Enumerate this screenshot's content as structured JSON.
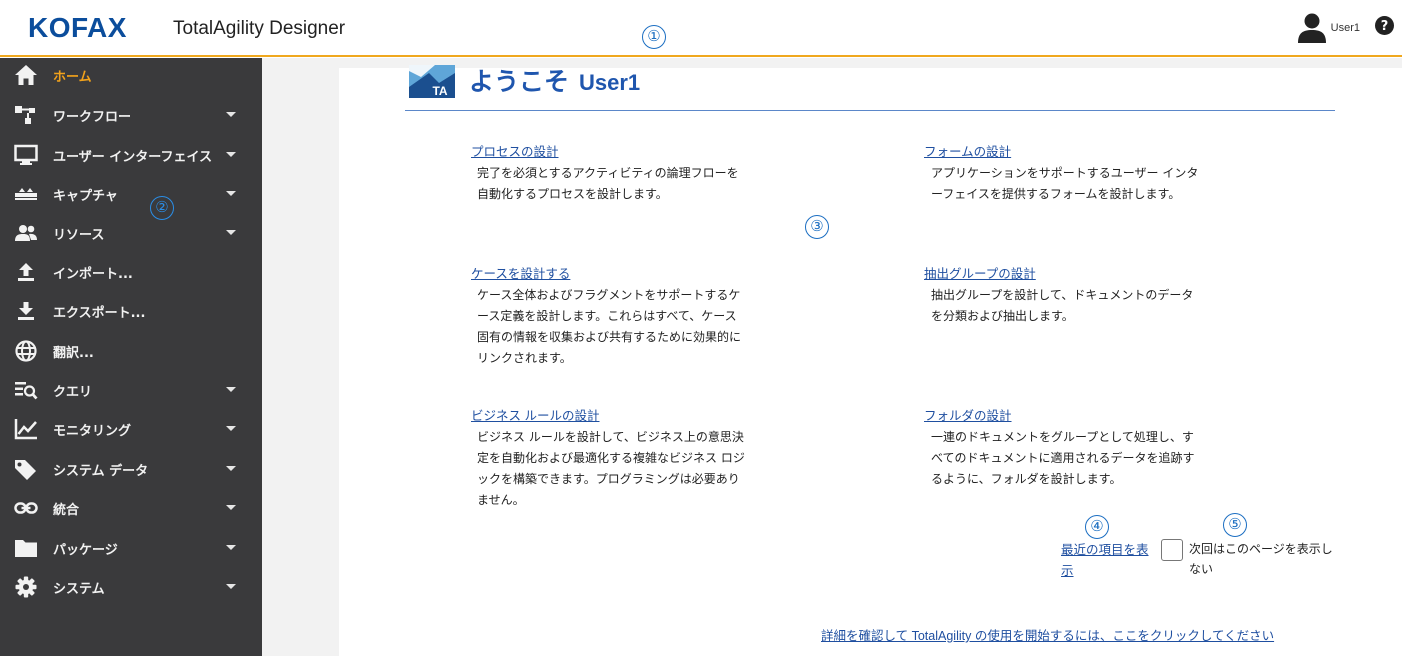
{
  "header": {
    "logo": "KOFAX",
    "app_title": "TotalAgility Designer",
    "user_name": "User1",
    "help_glyph": "?"
  },
  "callouts": [
    "①",
    "②",
    "③",
    "④",
    "⑤"
  ],
  "sidebar": {
    "items": [
      {
        "label": "ホーム",
        "icon": "home-icon",
        "active": true,
        "expandable": false
      },
      {
        "label": "ワークフロー",
        "icon": "workflow-icon",
        "expandable": true
      },
      {
        "label": "ユーザー インターフェイス",
        "icon": "monitor-icon",
        "expandable": true
      },
      {
        "label": "キャプチャ",
        "icon": "scanner-icon",
        "expandable": true
      },
      {
        "label": "リソース",
        "icon": "people-icon",
        "expandable": true
      },
      {
        "label": "インポート...",
        "icon": "upload-icon",
        "expandable": false
      },
      {
        "label": "エクスポート...",
        "icon": "download-icon",
        "expandable": false
      },
      {
        "label": "翻訳...",
        "icon": "globe-icon",
        "expandable": false
      },
      {
        "label": "クエリ",
        "icon": "query-icon",
        "expandable": true
      },
      {
        "label": "モニタリング",
        "icon": "chart-icon",
        "expandable": true
      },
      {
        "label": "システム データ",
        "icon": "tag-icon",
        "expandable": true
      },
      {
        "label": "統合",
        "icon": "link-icon",
        "expandable": true
      },
      {
        "label": "パッケージ",
        "icon": "folder-icon",
        "expandable": true
      },
      {
        "label": "システム",
        "icon": "gear-icon",
        "expandable": true
      }
    ]
  },
  "main": {
    "ta_logo_text": "TA",
    "welcome": "ようこそ",
    "welcome_user": "User1",
    "sections": [
      {
        "link": "プロセスの設計",
        "desc": "完了を必須とするアクティビティの論理フローを自動化するプロセスを設計します。"
      },
      {
        "link": "フォームの設計",
        "desc": "アプリケーションをサポートするユーザー インターフェイスを提供するフォームを設計します。"
      },
      {
        "link": "ケースを設計する",
        "desc": "ケース全体およびフラグメントをサポートするケース定義を設計します。これらはすべて、ケース固有の情報を収集および共有するために効果的にリンクされます。"
      },
      {
        "link": "抽出グループの設計",
        "desc": "抽出グループを設計して、ドキュメントのデータを分類および抽出します。"
      },
      {
        "link": "ビジネス ルールの設計",
        "desc": "ビジネス ルールを設計して、ビジネス上の意思決定を自動化および最適化する複雑なビジネス ロジックを構築できます。プログラミングは必要ありません。"
      },
      {
        "link": "フォルダの設計",
        "desc": "一連のドキュメントをグループとして処理し、すべてのドキュメントに適用されるデータを追跡するように、フォルダを設計します。"
      }
    ],
    "recent_link": "最近の項目を表示",
    "checkbox_label": "次回はこのページを表示しない",
    "footer_link": "詳細を確認して TotalAgility の使用を開始するには、ここをクリックしてください"
  },
  "colors": {
    "accent_orange": "#f0a81e",
    "brand_blue": "#0b4d9c",
    "link_blue": "#1f4fa0",
    "sidebar_bg": "#3a3a3c"
  }
}
